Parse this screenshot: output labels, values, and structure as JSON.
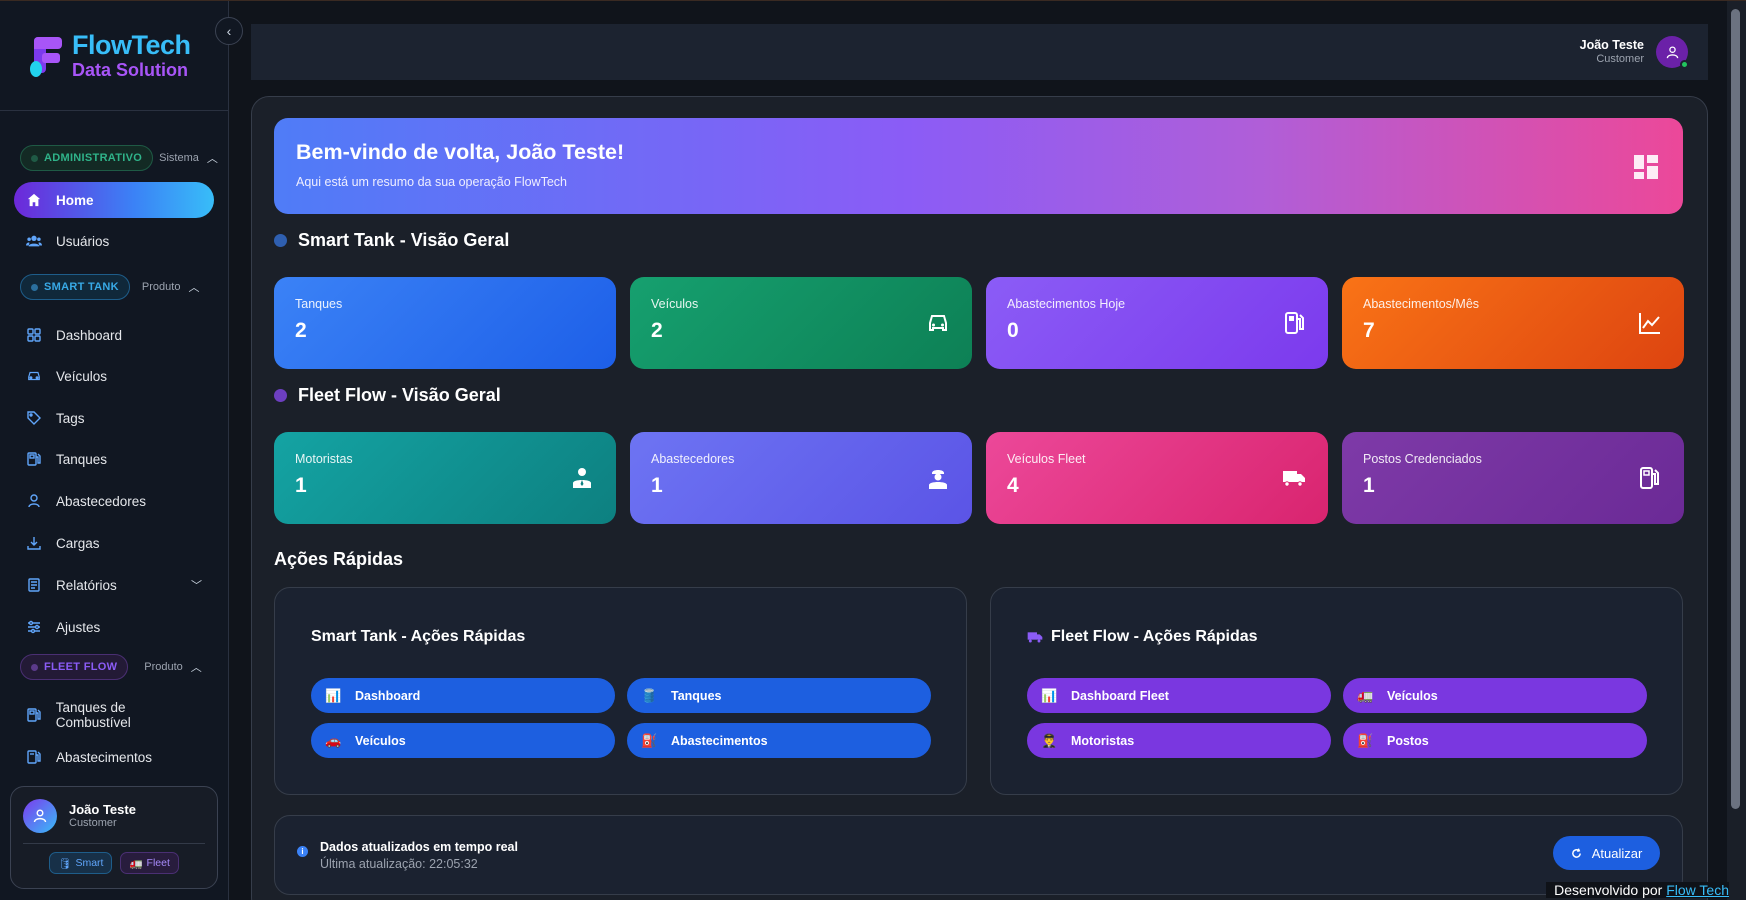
{
  "brand": {
    "line1": "FlowTech",
    "line2": "Data Solution"
  },
  "sidebar": {
    "sections": {
      "admin": {
        "badge": "ADMINISTRATIVO",
        "sub": "Sistema"
      },
      "smart": {
        "badge": "SMART TANK",
        "sub": "Produto"
      },
      "fleet": {
        "badge": "FLEET FLOW",
        "sub": "Produto"
      }
    },
    "admin_items": [
      {
        "label": "Home",
        "icon": "home-icon"
      },
      {
        "label": "Usuários",
        "icon": "users-icon"
      }
    ],
    "smart_items": [
      {
        "label": "Dashboard",
        "icon": "grid-icon"
      },
      {
        "label": "Veículos",
        "icon": "car-icon"
      },
      {
        "label": "Tags",
        "icon": "tag-icon"
      },
      {
        "label": "Tanques",
        "icon": "fuel-icon"
      },
      {
        "label": "Abastecedores",
        "icon": "person-icon"
      },
      {
        "label": "Cargas",
        "icon": "download-icon"
      },
      {
        "label": "Relatórios",
        "icon": "report-icon"
      },
      {
        "label": "Ajustes",
        "icon": "sliders-icon"
      }
    ],
    "fleet_items": [
      {
        "label": "Tanques de Combustível",
        "icon": "fuel-tank-icon"
      },
      {
        "label": "Abastecimentos",
        "icon": "fuel-pump-icon"
      }
    ],
    "user": {
      "name": "João Teste",
      "role": "Customer",
      "chip_smart": "Smart",
      "chip_fleet": "Fleet"
    }
  },
  "topbar": {
    "name": "João Teste",
    "role": "Customer"
  },
  "hero": {
    "title": "Bem-vindo de volta, João Teste!",
    "subtitle": "Aqui está um resumo da sua operação FlowTech"
  },
  "smart_section": {
    "title": "Smart Tank - Visão Geral",
    "cards": [
      {
        "label": "Tanques",
        "value": "2"
      },
      {
        "label": "Veículos",
        "value": "2"
      },
      {
        "label": "Abastecimentos Hoje",
        "value": "0"
      },
      {
        "label": "Abastecimentos/Mês",
        "value": "7"
      }
    ]
  },
  "fleet_section": {
    "title": "Fleet Flow - Visão Geral",
    "cards": [
      {
        "label": "Motoristas",
        "value": "1"
      },
      {
        "label": "Abastecedores",
        "value": "1"
      },
      {
        "label": "Veículos Fleet",
        "value": "4"
      },
      {
        "label": "Postos Credenciados",
        "value": "1"
      }
    ]
  },
  "quick_actions": {
    "title": "Ações Rápidas",
    "smart": {
      "title": "Smart Tank - Ações Rápidas",
      "buttons": [
        {
          "label": "Dashboard",
          "emoji": "📊"
        },
        {
          "label": "Tanques",
          "emoji": "🛢️"
        },
        {
          "label": "Veículos",
          "emoji": "🚗"
        },
        {
          "label": "Abastecimentos",
          "emoji": "⛽"
        }
      ]
    },
    "fleet": {
      "title": "Fleet Flow - Ações Rápidas",
      "buttons": [
        {
          "label": "Dashboard Fleet",
          "emoji": "📊"
        },
        {
          "label": "Veículos",
          "emoji": "🚛"
        },
        {
          "label": "Motoristas",
          "emoji": "👨‍✈️"
        },
        {
          "label": "Postos",
          "emoji": "⛽"
        }
      ]
    }
  },
  "status": {
    "line1": "Dados atualizados em tempo real",
    "line2": "Última atualização: 22:05:32",
    "refresh": "Atualizar"
  },
  "footer": {
    "text": "Desenvolvido por",
    "link": "Flow Tech"
  },
  "colors": {
    "smart_dot": "#2563eb",
    "fleet_dot": "#7c3aed",
    "card_tanques": "#2563eb",
    "card_veiculos": "#0f9d6e",
    "card_abast_hoje": "#7c3aed",
    "card_abast_mes": "#ea580c",
    "card_motoristas": "#0d9488",
    "card_abastecedores": "#6366f1",
    "card_veiculos_fleet": "#db2777",
    "card_postos": "#6b21a8"
  }
}
